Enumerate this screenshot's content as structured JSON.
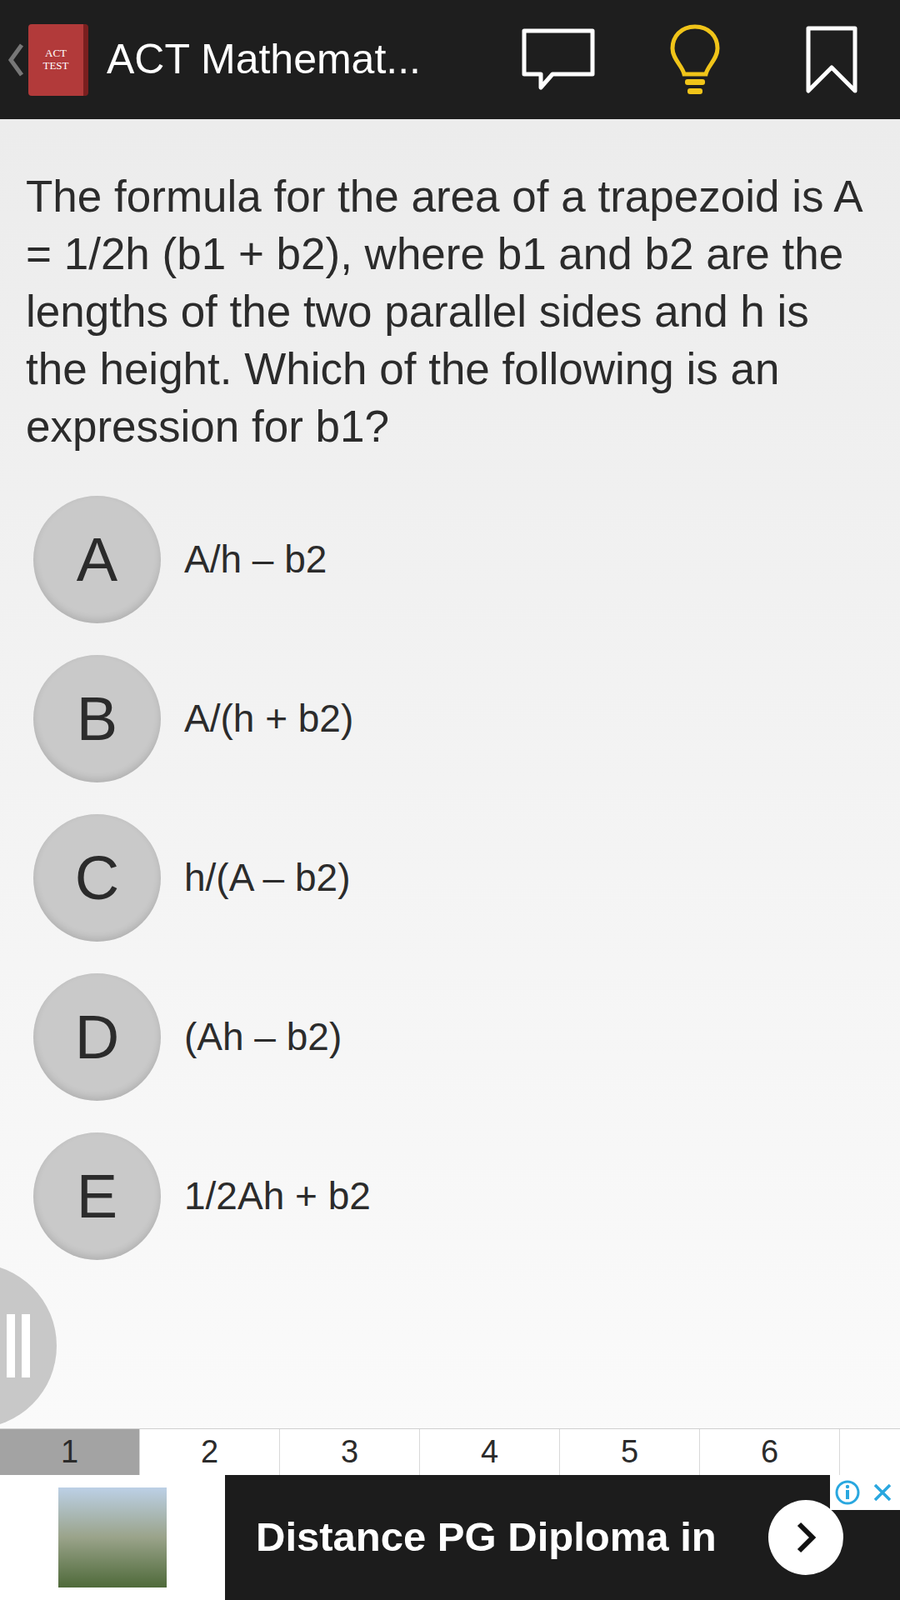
{
  "app_bar": {
    "logo_text": [
      "ACT",
      "TEST"
    ],
    "title": "ACT Mathemat..."
  },
  "question": "The formula for the area of a trapezoid is A = 1/2h (b1 + b2), where b1 and b2 are the lengths of the two parallel sides and h is the height. Which of the following is an expression for b1?",
  "options": [
    {
      "letter": "A",
      "text": "A/h – b2",
      "selected": false
    },
    {
      "letter": "B",
      "text": "A/(h + b2)",
      "selected": false
    },
    {
      "letter": "C",
      "text": "h/(A – b2)",
      "selected": false
    },
    {
      "letter": "D",
      "text": "(Ah – b2)",
      "selected": false
    },
    {
      "letter": "E",
      "text": "1/2Ah + b2",
      "selected": false
    }
  ],
  "pages": [
    {
      "label": "1",
      "selected": true
    },
    {
      "label": "2",
      "selected": false
    },
    {
      "label": "3",
      "selected": false
    },
    {
      "label": "4",
      "selected": false
    },
    {
      "label": "5",
      "selected": false
    },
    {
      "label": "6",
      "selected": false
    }
  ],
  "ad": {
    "text": "Distance PG Diploma in"
  }
}
